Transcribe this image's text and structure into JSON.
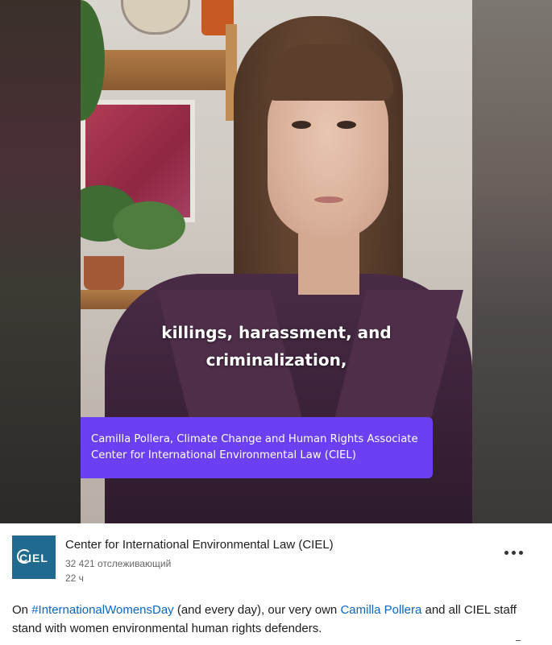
{
  "video": {
    "subtitle_line1": "killings, harassment, and",
    "subtitle_line2": "criminalization,",
    "namecard_line1": "Camilla Pollera, Climate Change and Human Rights Associate",
    "namecard_line2": "Center for International Environmental Law (CIEL)",
    "namecard_color": "#6b3ff2"
  },
  "author": {
    "logo_text": "CIEL",
    "logo_color": "#1f6a8e",
    "name": "Center for International Environmental Law (CIEL)",
    "followers": "32 421 отслеживающий",
    "time": "22 ч"
  },
  "post": {
    "prefix": "On ",
    "hashtag": "#InternationalWomensDay",
    "middle": " (and every day), our very own ",
    "mention": "Camilla Pollera",
    "suffix": " and all CIEL staff stand with women environmental human rights defenders.",
    "link_color": "#0a66c2"
  },
  "icons": {
    "more": "more-horizontal-icon"
  }
}
